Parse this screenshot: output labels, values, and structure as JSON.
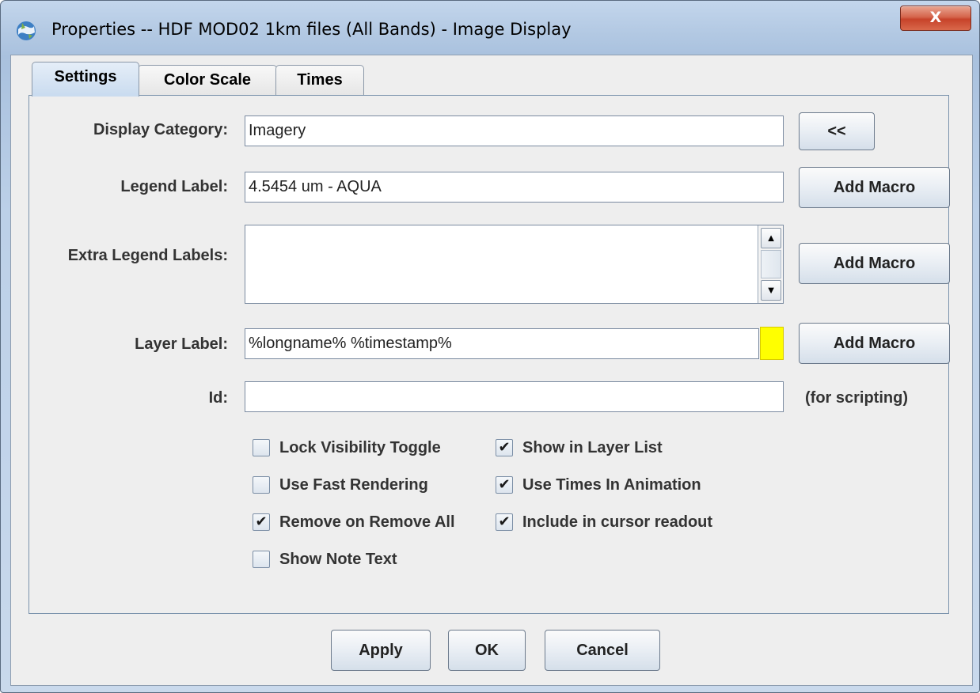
{
  "window": {
    "title": "Properties -- HDF MOD02 1km files (All Bands) - Image Display",
    "close_glyph": "X"
  },
  "tabs": [
    {
      "label": "Settings",
      "active": true
    },
    {
      "label": "Color Scale",
      "active": false
    },
    {
      "label": "Times",
      "active": false
    }
  ],
  "settings": {
    "display_category": {
      "label": "Display Category:",
      "value": "Imagery",
      "button": "<<"
    },
    "legend_label": {
      "label": "Legend Label:",
      "value": "4.5454 um - AQUA",
      "button": "Add Macro"
    },
    "extra_legend_labels": {
      "label": "Extra Legend Labels:",
      "value": "",
      "button": "Add Macro"
    },
    "layer_label": {
      "label": "Layer Label:",
      "value": "%longname% %timestamp%",
      "button": "Add Macro",
      "color": "#ffff00"
    },
    "id": {
      "label": "Id:",
      "value": "",
      "note": "(for scripting)"
    }
  },
  "checkboxes": [
    {
      "label": "Lock Visibility Toggle",
      "checked": false
    },
    {
      "label": "Show in Layer List",
      "checked": true
    },
    {
      "label": "Use Fast Rendering",
      "checked": false
    },
    {
      "label": "Use Times In Animation",
      "checked": true
    },
    {
      "label": "Remove on Remove All",
      "checked": true
    },
    {
      "label": "Include in cursor readout",
      "checked": true
    },
    {
      "label": "Show Note Text",
      "checked": false
    }
  ],
  "footer": {
    "apply": "Apply",
    "ok": "OK",
    "cancel": "Cancel"
  },
  "icons": {
    "app": "idv-globe-icon",
    "check": "✔",
    "scroll_up": "▲",
    "scroll_down": "▼"
  }
}
